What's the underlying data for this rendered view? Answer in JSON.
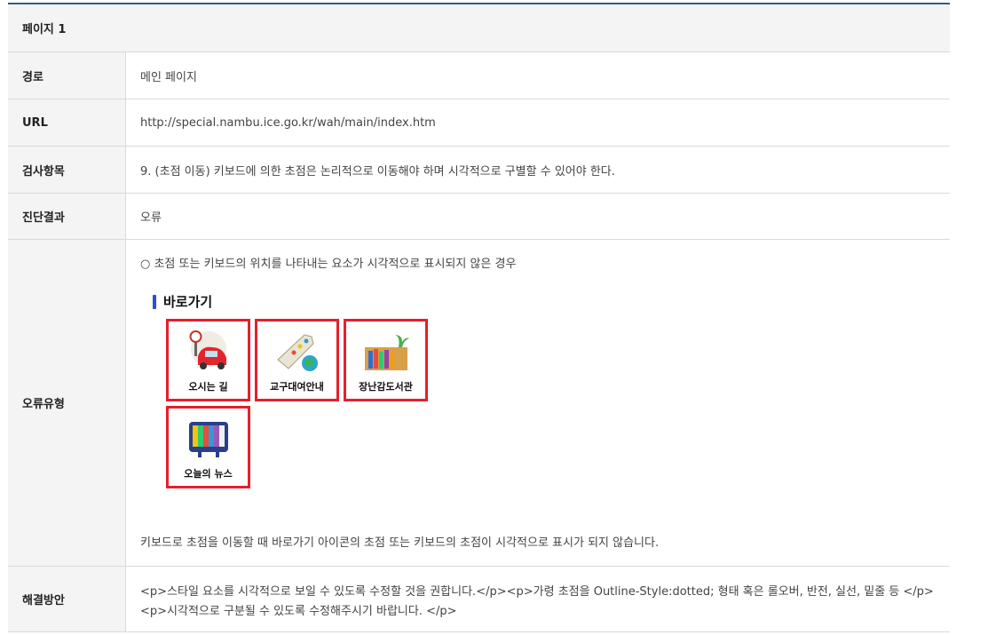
{
  "header": {
    "title": "페이지 1"
  },
  "rows": {
    "path": {
      "label": "경로",
      "value": "메인 페이지"
    },
    "url": {
      "label": "URL",
      "value": "http://special.nambu.ice.go.kr/wah/main/index.htm"
    },
    "item": {
      "label": "검사항목",
      "value": "9. (초점 이동) 키보드에 의한 초점은 논리적으로 이동해야 하며 시각적으로 구별할 수 있어야 한다."
    },
    "result": {
      "label": "진단결과",
      "value": "오류"
    },
    "type": {
      "label": "오류유형",
      "line1": "○ 초점 또는 키보드의 위치를 나타내는 요소가 시각적으로 표시되지 않은 경우",
      "screenshot_title": "바로가기",
      "tiles": [
        "오시는 길",
        "교구대여안내",
        "장난감도서관",
        "오늘의 뉴스"
      ],
      "description": "키보드로 초점을 이동할 때 바로가기 아이콘의 초점 또는 키보드의 초점이 시각적으로 표시가 되지 않습니다."
    },
    "fix": {
      "label": "해결방안",
      "value": "<p>스타일 요소를 시각적으로 보일 수 있도록 수정할 것을 권합니다.</p><p>가령 초점을 Outline-Style:dotted; 형태 혹은 롤오버, 반전, 실선, 밑줄 등 </p><p>시각적으로 구분될 수 있도록 수정해주시기 바랍니다. </p>"
    }
  },
  "colors": {
    "accent": "#2f5d8a",
    "focus_border": "#e4202c",
    "bar": "#2a4fd0"
  }
}
